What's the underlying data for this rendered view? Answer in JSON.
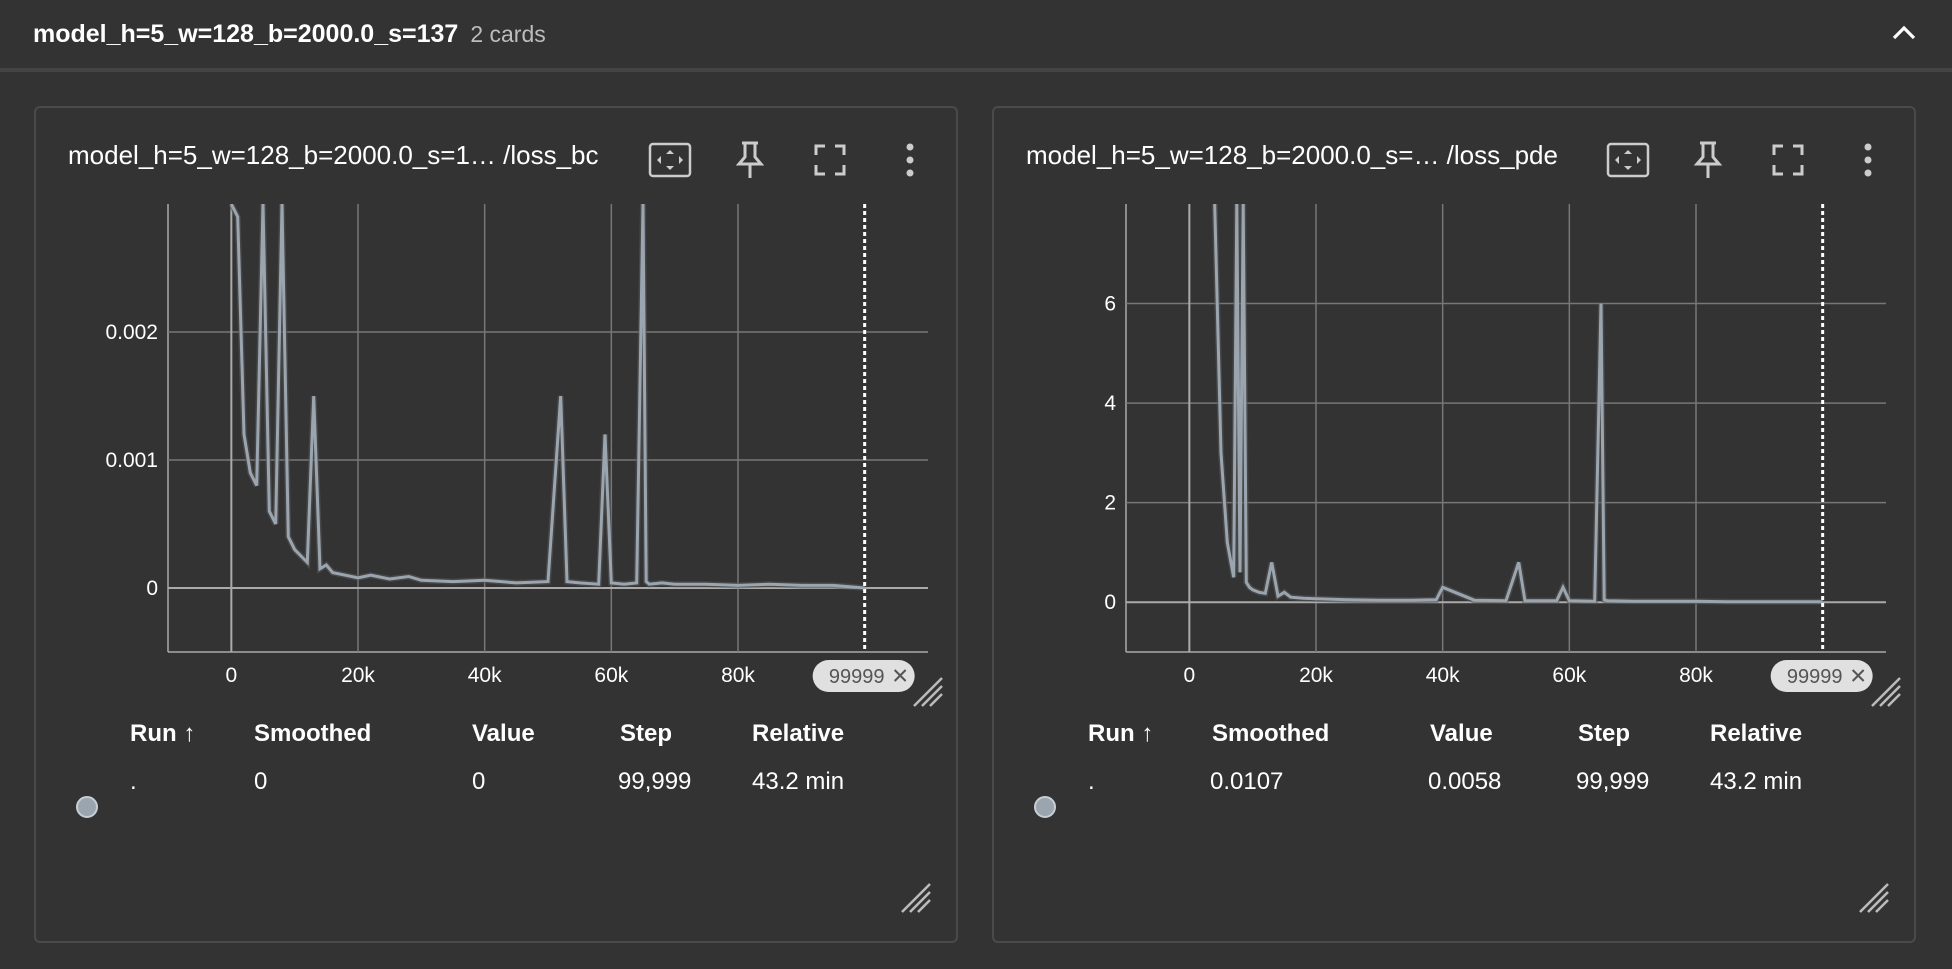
{
  "group": {
    "title": "model_h=5_w=128_b=2000.0_s=137",
    "count": "2 cards"
  },
  "table_headers": {
    "run": "Run ↑",
    "smoothed": "Smoothed",
    "value": "Value",
    "step": "Step",
    "relative": "Relative"
  },
  "cards": [
    {
      "title": "model_h=5_w=128_b=2000.0_s=1… /loss_bc",
      "step_badge": "99999",
      "row": {
        "run": ".",
        "smoothed": "0",
        "value": "0",
        "step": "99,999",
        "relative": "43.2 min"
      },
      "chart_data": {
        "type": "line",
        "x_ticks": [
          "0",
          "20k",
          "40k",
          "60k",
          "80k"
        ],
        "y_ticks": [
          "0",
          "0.001",
          "0.002"
        ],
        "xlim": [
          -10000,
          110000
        ],
        "ylim": [
          -0.0005,
          0.003
        ],
        "cursor_step": 99999,
        "grid": true,
        "series": [
          {
            "color": "#9aa5b0",
            "x": [
              0,
              1000,
              2000,
              3000,
              4000,
              5000,
              6000,
              7000,
              8000,
              9000,
              10000,
              11000,
              12000,
              13000,
              14000,
              15000,
              16000,
              18000,
              20000,
              22000,
              25000,
              28000,
              30000,
              35000,
              40000,
              45000,
              50000,
              52000,
              53000,
              55000,
              58000,
              59000,
              60000,
              62000,
              64000,
              65000,
              65500,
              66000,
              68000,
              70000,
              75000,
              80000,
              85000,
              90000,
              95000,
              99999
            ],
            "y": [
              0.003,
              0.0029,
              0.0012,
              0.0009,
              0.0008,
              0.003,
              0.0006,
              0.0005,
              0.003,
              0.0004,
              0.0003,
              0.00025,
              0.0002,
              0.0015,
              0.00015,
              0.00018,
              0.00012,
              0.0001,
              8e-05,
              0.0001,
              7e-05,
              9e-05,
              6e-05,
              5e-05,
              6e-05,
              4e-05,
              5e-05,
              0.0015,
              5e-05,
              4e-05,
              3e-05,
              0.0012,
              4e-05,
              3e-05,
              4e-05,
              0.003,
              5e-05,
              3e-05,
              4e-05,
              3e-05,
              3e-05,
              2e-05,
              3e-05,
              2e-05,
              2e-05,
              0.0
            ]
          }
        ]
      }
    },
    {
      "title": "model_h=5_w=128_b=2000.0_s=… /loss_pde",
      "step_badge": "99999",
      "row": {
        "run": ".",
        "smoothed": "0.0107",
        "value": "0.0058",
        "step": "99,999",
        "relative": "43.2 min"
      },
      "chart_data": {
        "type": "line",
        "x_ticks": [
          "0",
          "20k",
          "40k",
          "60k",
          "80k"
        ],
        "y_ticks": [
          "0",
          "2",
          "4",
          "6"
        ],
        "xlim": [
          -10000,
          110000
        ],
        "ylim": [
          -1,
          8
        ],
        "cursor_step": 99999,
        "grid": true,
        "series": [
          {
            "color": "#9aa5b0",
            "x": [
              4000,
              5000,
              6000,
              7000,
              7500,
              8000,
              8500,
              9000,
              9500,
              10000,
              11000,
              12000,
              13000,
              14000,
              15000,
              16000,
              18000,
              20000,
              25000,
              30000,
              35000,
              39000,
              40000,
              45000,
              50000,
              52000,
              53000,
              58000,
              59000,
              60000,
              64000,
              65000,
              65500,
              66000,
              70000,
              75000,
              80000,
              85000,
              90000,
              95000,
              99999
            ],
            "y": [
              8,
              3,
              1.2,
              0.5,
              8,
              0.6,
              8,
              0.4,
              0.3,
              0.25,
              0.2,
              0.18,
              0.8,
              0.12,
              0.2,
              0.1,
              0.08,
              0.07,
              0.05,
              0.04,
              0.04,
              0.05,
              0.3,
              0.04,
              0.03,
              0.8,
              0.03,
              0.03,
              0.3,
              0.03,
              0.02,
              6,
              0.05,
              0.03,
              0.02,
              0.02,
              0.02,
              0.01,
              0.01,
              0.01,
              0.01
            ]
          }
        ]
      }
    }
  ]
}
